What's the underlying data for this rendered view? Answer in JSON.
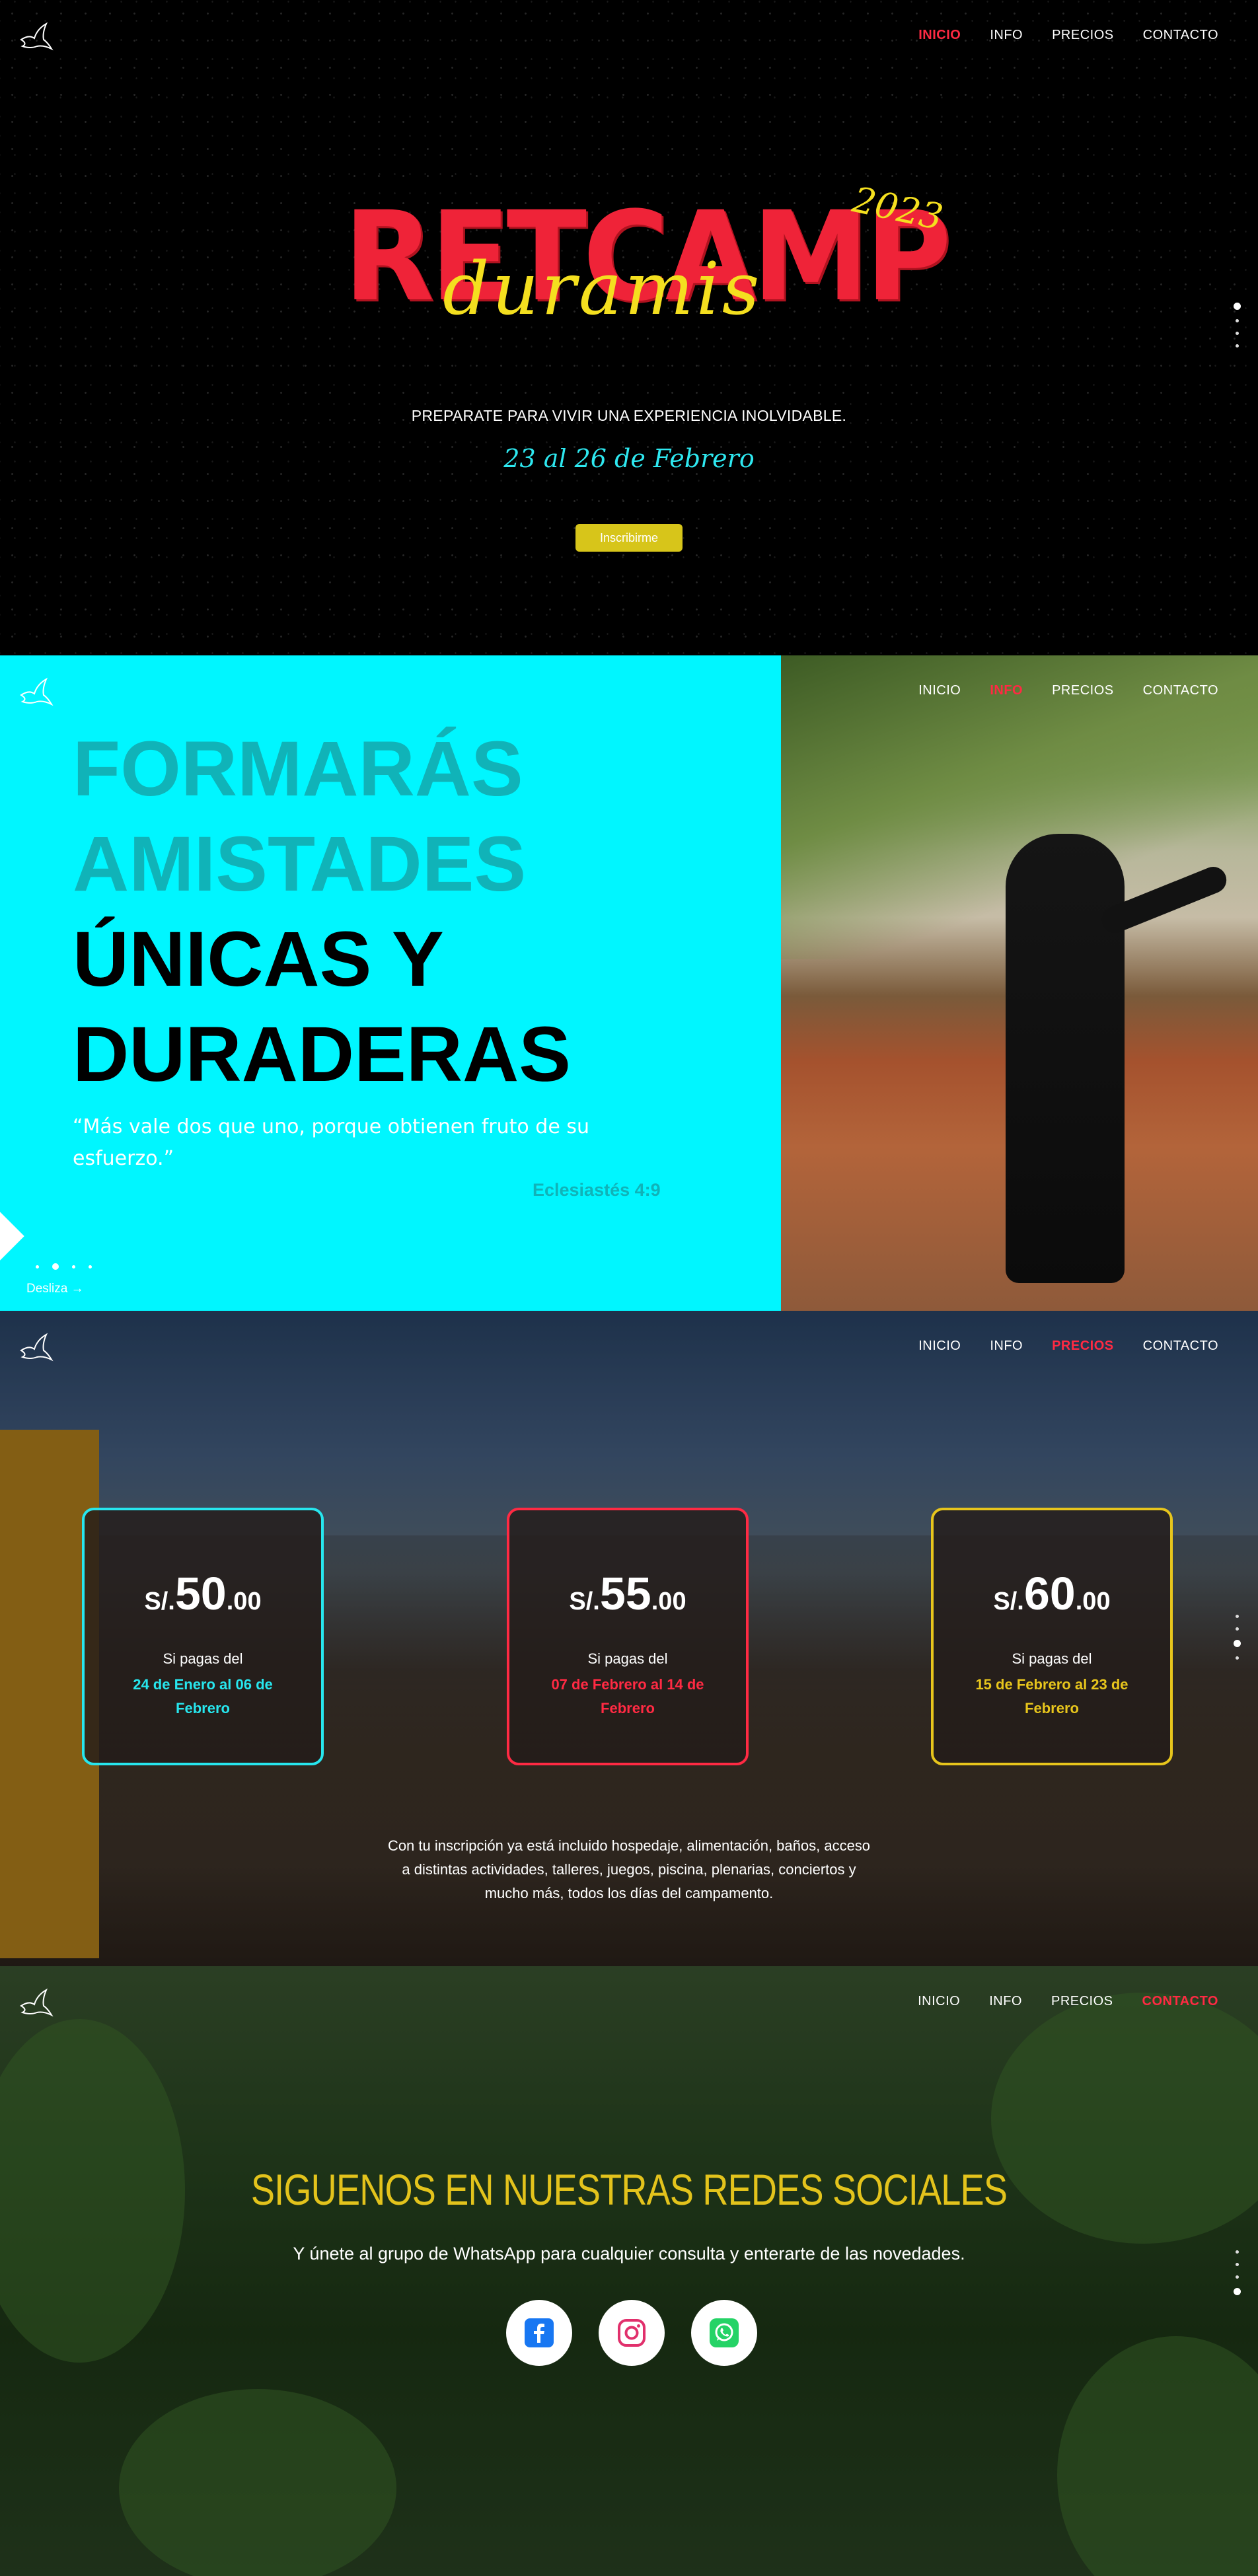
{
  "nav": {
    "items": [
      "INICIO",
      "INFO",
      "PRECIOS",
      "CONTACTO"
    ]
  },
  "hero": {
    "title": "RETCAMP",
    "script": "duramis",
    "year": "2023",
    "tagline": "PREPARATE PARA VIVIR UNA EXPERIENCIA INOLVIDABLE.",
    "dates": "23 al 26 de Febrero",
    "cta": "Inscribirme"
  },
  "info": {
    "headline": [
      "FORMARÁS",
      "AMISTADES",
      "ÚNICAS Y",
      "DURADERAS"
    ],
    "quote": "“Más vale dos que uno, porque obtienen fruto de su esfuerzo.”",
    "reference": "Eclesiastés 4:9",
    "swipe": "Desliza →"
  },
  "prices": {
    "cards": [
      {
        "currency": "S/.",
        "amount": "50",
        "cents": ".00",
        "pay_label": "Si pagas del",
        "range": "24 de Enero al 06 de Febrero",
        "color": "#27e6ee"
      },
      {
        "currency": "S/.",
        "amount": "55",
        "cents": ".00",
        "pay_label": "Si pagas del",
        "range": "07 de Febrero al 14 de Febrero",
        "color": "#ff2a43"
      },
      {
        "currency": "S/.",
        "amount": "60",
        "cents": ".00",
        "pay_label": "Si pagas del",
        "range": "15 de Febrero al 23 de Febrero",
        "color": "#e7c51c"
      }
    ],
    "note": "Con tu inscripción ya está incluido hospedaje, alimentación, baños, acceso a distintas actividades, talleres, juegos, piscina, plenarias, conciertos y mucho más, todos los días del campamento."
  },
  "social": {
    "title": "SIGUENOS EN NUESTRAS REDES SOCIALES",
    "subtitle": "Y únete al grupo de WhatsApp para cualquier consulta y enterarte de las novedades.",
    "icons": [
      "facebook-icon",
      "instagram-icon",
      "whatsapp-icon"
    ]
  },
  "colors": {
    "accent_red": "#ff2a43",
    "cyan": "#00f6ff",
    "yellow": "#e3c31c"
  }
}
